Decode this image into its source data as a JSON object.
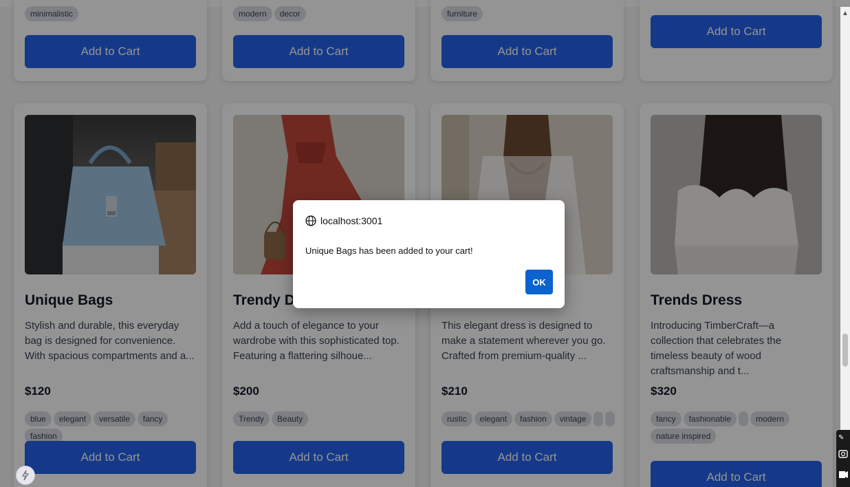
{
  "top_row": [
    {
      "tags": [
        "minimalistic"
      ],
      "button": "Add to Cart"
    },
    {
      "tags": [
        "modern",
        "decor"
      ],
      "button": "Add to Cart"
    },
    {
      "tags": [
        "furniture"
      ],
      "button": "Add to Cart"
    },
    {
      "tags": [],
      "button": "Add to Cart"
    }
  ],
  "products": [
    {
      "title": "Unique Bags",
      "description": "Stylish and durable, this everyday bag is designed for convenience. With spacious compartments and a...",
      "price": "$120",
      "tags": [
        "blue",
        "elegant",
        "versatile",
        "fancy",
        "fashion"
      ],
      "button": "Add to Cart",
      "image_icon": "handbag-image"
    },
    {
      "title": "Trendy Dre",
      "description": "Add a touch of elegance to your wardrobe with this sophisticated top. Featuring a flattering silhoue...",
      "price": "$200",
      "tags": [
        "Trendy",
        "Beauty"
      ],
      "button": "Add to Cart",
      "image_icon": "red-dress-image"
    },
    {
      "title": "",
      "description": "This elegant dress is designed to make a statement wherever you go. Crafted from premium-quality ...",
      "price": "$210",
      "tags": [
        "rustic",
        "elegant",
        "fashion",
        "vintage",
        "",
        ""
      ],
      "button": "Add to Cart",
      "image_icon": "white-blouse-image"
    },
    {
      "title": "Trends Dress",
      "description": "Introducing TimberCraft—a collection that celebrates the timeless beauty of wood craftsmanship and t...",
      "price": "$320",
      "tags": [
        "fancy",
        "fashionable",
        "",
        "modern",
        "nature inspired"
      ],
      "button": "Add to Cart",
      "image_icon": "ruffle-top-image"
    }
  ],
  "dialog": {
    "host": "localhost:3001",
    "message": "Unique Bags has been added to your cart!",
    "ok_label": "OK",
    "icon": "globe-icon"
  },
  "colors": {
    "button": "#2563eb",
    "ok_button": "#0b63ce",
    "overlay": "rgba(0,0,0,0.42)"
  }
}
